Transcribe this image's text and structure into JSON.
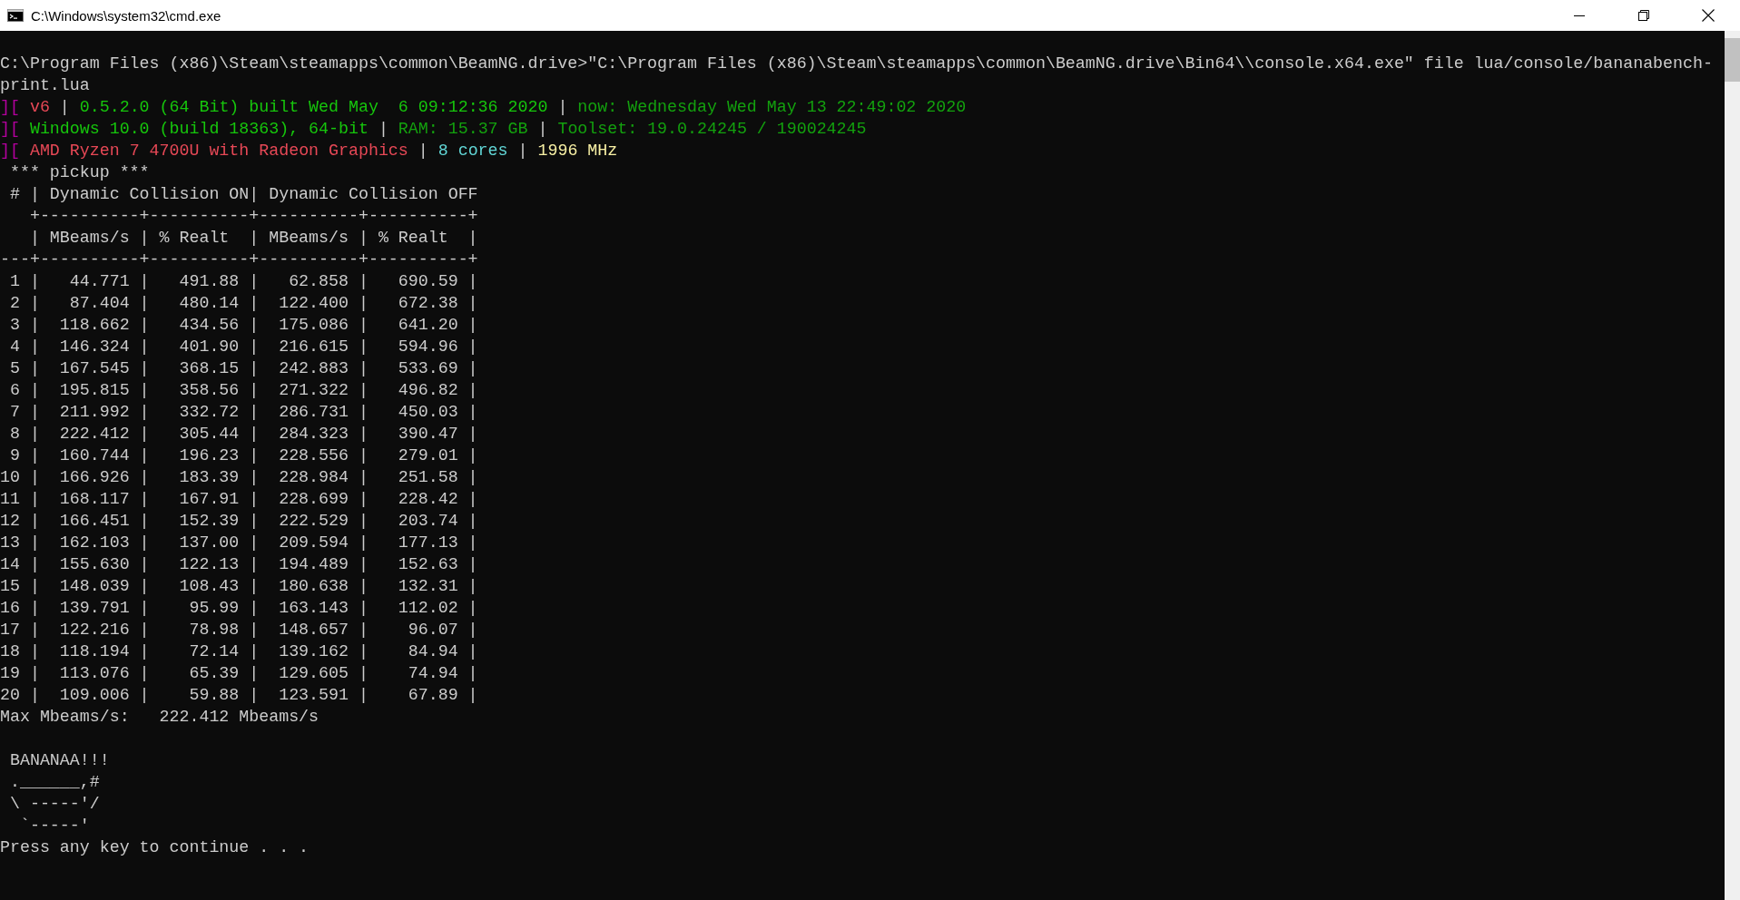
{
  "window": {
    "title": "C:\\Windows\\system32\\cmd.exe"
  },
  "lines": [
    {
      "kind": "blank"
    },
    {
      "kind": "plain",
      "text": "C:\\Program Files (x86)\\Steam\\steamapps\\common\\BeamNG.drive>\"C:\\Program Files (x86)\\Steam\\steamapps\\common\\BeamNG.drive\\Bin64\\\\console.x64.exe\" file lua/console/bananabench-"
    },
    {
      "kind": "plain",
      "text": "print.lua"
    },
    {
      "kind": "colored",
      "segments": [
        {
          "text": "][",
          "color": "#b4009e"
        },
        {
          "text": " v6 ",
          "color": "#e74856"
        },
        {
          "text": "|"
        },
        {
          "text": " 0.5.2.0 (64 Bit) built Wed May  6 09:12:36 2020 ",
          "color": "#16c60c"
        },
        {
          "text": "|"
        },
        {
          "text": " now: Wednesday Wed May 13 22:49:02 2020",
          "color": "#13a10e"
        }
      ]
    },
    {
      "kind": "colored",
      "segments": [
        {
          "text": "][",
          "color": "#b4009e"
        },
        {
          "text": " Windows 10.0 (build 18363), 64-bit ",
          "color": "#16c60c"
        },
        {
          "text": "|"
        },
        {
          "text": " RAM: 15.37 GB ",
          "color": "#13a10e"
        },
        {
          "text": "|"
        },
        {
          "text": " Toolset: 19.0.24245 / 190024245",
          "color": "#13a10e"
        }
      ]
    },
    {
      "kind": "colored",
      "segments": [
        {
          "text": "][",
          "color": "#b4009e"
        },
        {
          "text": " AMD Ryzen 7 4700U with Radeon Graphics ",
          "color": "#e74856"
        },
        {
          "text": "|"
        },
        {
          "text": " 8 cores ",
          "color": "#61d6d6"
        },
        {
          "text": "|"
        },
        {
          "text": " 1996 MHz",
          "color": "#f9f1a5"
        }
      ]
    },
    {
      "kind": "plain",
      "text": " *** pickup ***"
    },
    {
      "kind": "plain",
      "text": " # | Dynamic Collision ON| Dynamic Collision OFF"
    },
    {
      "kind": "plain",
      "text": "   +----------+----------+----------+----------+"
    },
    {
      "kind": "plain",
      "text": "   | MBeams/s | % Realt  | MBeams/s | % Realt  |"
    },
    {
      "kind": "plain",
      "text": "---+----------+----------+----------+----------+"
    },
    {
      "kind": "plain",
      "text": " 1 |   44.771 |   491.88 |   62.858 |   690.59 |"
    },
    {
      "kind": "plain",
      "text": " 2 |   87.404 |   480.14 |  122.400 |   672.38 |"
    },
    {
      "kind": "plain",
      "text": " 3 |  118.662 |   434.56 |  175.086 |   641.20 |"
    },
    {
      "kind": "plain",
      "text": " 4 |  146.324 |   401.90 |  216.615 |   594.96 |"
    },
    {
      "kind": "plain",
      "text": " 5 |  167.545 |   368.15 |  242.883 |   533.69 |"
    },
    {
      "kind": "plain",
      "text": " 6 |  195.815 |   358.56 |  271.322 |   496.82 |"
    },
    {
      "kind": "plain",
      "text": " 7 |  211.992 |   332.72 |  286.731 |   450.03 |"
    },
    {
      "kind": "plain",
      "text": " 8 |  222.412 |   305.44 |  284.323 |   390.47 |"
    },
    {
      "kind": "plain",
      "text": " 9 |  160.744 |   196.23 |  228.556 |   279.01 |"
    },
    {
      "kind": "plain",
      "text": "10 |  166.926 |   183.39 |  228.984 |   251.58 |"
    },
    {
      "kind": "plain",
      "text": "11 |  168.117 |   167.91 |  228.699 |   228.42 |"
    },
    {
      "kind": "plain",
      "text": "12 |  166.451 |   152.39 |  222.529 |   203.74 |"
    },
    {
      "kind": "plain",
      "text": "13 |  162.103 |   137.00 |  209.594 |   177.13 |"
    },
    {
      "kind": "plain",
      "text": "14 |  155.630 |   122.13 |  194.489 |   152.63 |"
    },
    {
      "kind": "plain",
      "text": "15 |  148.039 |   108.43 |  180.638 |   132.31 |"
    },
    {
      "kind": "plain",
      "text": "16 |  139.791 |    95.99 |  163.143 |   112.02 |"
    },
    {
      "kind": "plain",
      "text": "17 |  122.216 |    78.98 |  148.657 |    96.07 |"
    },
    {
      "kind": "plain",
      "text": "18 |  118.194 |    72.14 |  139.162 |    84.94 |"
    },
    {
      "kind": "plain",
      "text": "19 |  113.076 |    65.39 |  129.605 |    74.94 |"
    },
    {
      "kind": "plain",
      "text": "20 |  109.006 |    59.88 |  123.591 |    67.89 |"
    },
    {
      "kind": "plain",
      "text": "Max Mbeams/s:   222.412 Mbeams/s"
    },
    {
      "kind": "blank"
    },
    {
      "kind": "plain",
      "text": " BANANAA!!!"
    },
    {
      "kind": "plain",
      "text": " .______,#"
    },
    {
      "kind": "plain",
      "text": " \\ -----'/"
    },
    {
      "kind": "plain",
      "text": "  `-----'"
    },
    {
      "kind": "plain",
      "text": "Press any key to continue . . ."
    }
  ]
}
